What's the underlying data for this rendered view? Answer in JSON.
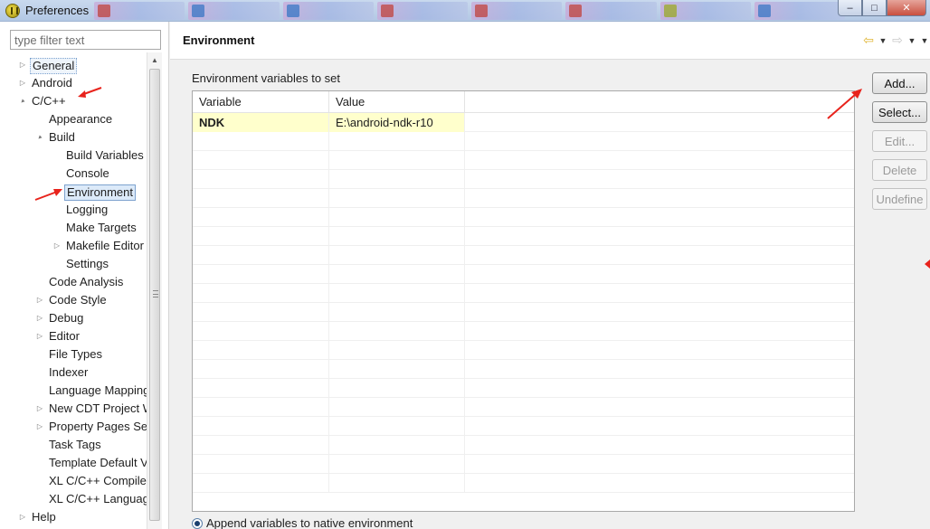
{
  "window": {
    "title": "Preferences",
    "controls": {
      "minimize": "–",
      "maximize": "□",
      "close": "✕"
    }
  },
  "filter": {
    "placeholder": "type filter text",
    "value": ""
  },
  "tree": {
    "items": [
      {
        "label": "General",
        "indent": 0,
        "expander": "collapsed",
        "state": "boxed"
      },
      {
        "label": "Android",
        "indent": 0,
        "expander": "collapsed"
      },
      {
        "label": "C/C++",
        "indent": 0,
        "expander": "expanded"
      },
      {
        "label": "Appearance",
        "indent": 1,
        "expander": "none"
      },
      {
        "label": "Build",
        "indent": 1,
        "expander": "expanded"
      },
      {
        "label": "Build Variables",
        "indent": 2,
        "expander": "none"
      },
      {
        "label": "Console",
        "indent": 2,
        "expander": "none"
      },
      {
        "label": "Environment",
        "indent": 2,
        "expander": "none",
        "state": "selected"
      },
      {
        "label": "Logging",
        "indent": 2,
        "expander": "none"
      },
      {
        "label": "Make Targets",
        "indent": 2,
        "expander": "none"
      },
      {
        "label": "Makefile Editor",
        "indent": 2,
        "expander": "collapsed"
      },
      {
        "label": "Settings",
        "indent": 2,
        "expander": "none"
      },
      {
        "label": "Code Analysis",
        "indent": 1,
        "expander": "none"
      },
      {
        "label": "Code Style",
        "indent": 1,
        "expander": "collapsed"
      },
      {
        "label": "Debug",
        "indent": 1,
        "expander": "collapsed"
      },
      {
        "label": "Editor",
        "indent": 1,
        "expander": "collapsed"
      },
      {
        "label": "File Types",
        "indent": 1,
        "expander": "none"
      },
      {
        "label": "Indexer",
        "indent": 1,
        "expander": "none"
      },
      {
        "label": "Language Mappings",
        "indent": 1,
        "expander": "none"
      },
      {
        "label": "New CDT Project Wizard",
        "indent": 1,
        "expander": "collapsed"
      },
      {
        "label": "Property Pages Settings",
        "indent": 1,
        "expander": "collapsed"
      },
      {
        "label": "Task Tags",
        "indent": 1,
        "expander": "none"
      },
      {
        "label": "Template Default Values",
        "indent": 1,
        "expander": "none"
      },
      {
        "label": "XL C/C++ Compiler",
        "indent": 1,
        "expander": "none"
      },
      {
        "label": "XL C/C++ Language",
        "indent": 1,
        "expander": "none"
      },
      {
        "label": "Help",
        "indent": 0,
        "expander": "collapsed"
      }
    ]
  },
  "page": {
    "title": "Environment",
    "section_label": "Environment variables to set",
    "table": {
      "columns": [
        "Variable",
        "Value"
      ],
      "rows": [
        {
          "variable": "NDK",
          "value": "E:\\android-ndk-r10"
        }
      ]
    },
    "buttons": [
      {
        "label": "Add...",
        "enabled": true
      },
      {
        "label": "Select...",
        "enabled": true
      },
      {
        "label": "Edit...",
        "enabled": false
      },
      {
        "label": "Delete",
        "enabled": false
      },
      {
        "label": "Undefine",
        "enabled": false
      }
    ],
    "radio": {
      "label": "Append variables to native environment",
      "checked": true
    }
  },
  "icons": {
    "expanded": "▲",
    "collapsed": "▷",
    "nav_back": "⇦",
    "nav_forward": "⇨",
    "dropdown": "▼"
  },
  "colors": {
    "highlight_row": "#ffffcc",
    "selection": "#dceaf9",
    "annotation": "#e8231c"
  }
}
